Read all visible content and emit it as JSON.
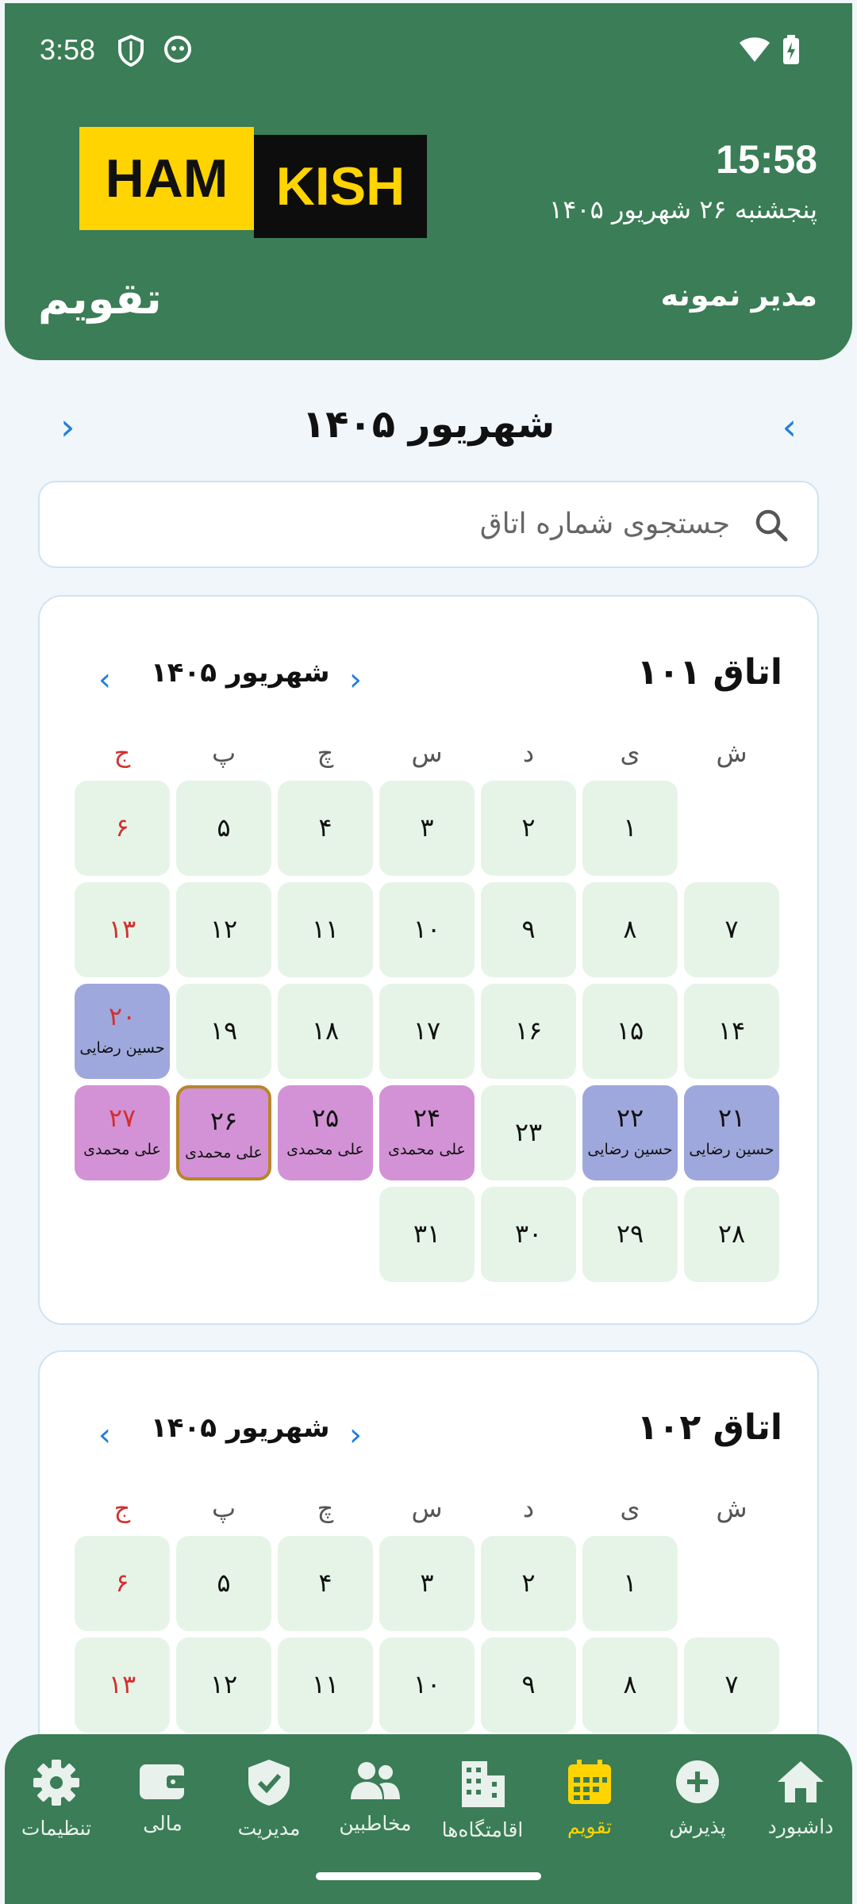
{
  "status_bar": {
    "time": "3:58"
  },
  "header": {
    "logo_left": "HAM",
    "logo_right": "KISH",
    "clock": "15:58",
    "date": "پنجشنبه ۲۶ شهریور ۱۴۰۵",
    "page_title": "تقویم",
    "user_name": "مدیر نمونه"
  },
  "month_nav": {
    "title": "شهریور ۱۴۰۵",
    "prev_arrow": "‹",
    "next_arrow": "›"
  },
  "search": {
    "placeholder": "جستجوی شماره اتاق"
  },
  "weekdays": [
    "ش",
    "ی",
    "د",
    "س",
    "چ",
    "پ",
    "ج"
  ],
  "rooms": [
    {
      "title": "اتاق ۱۰۱",
      "month": "شهریور ۱۴۰۵",
      "days": [
        {
          "n": "۱"
        },
        {
          "n": "۲"
        },
        {
          "n": "۳"
        },
        {
          "n": "۴"
        },
        {
          "n": "۵"
        },
        {
          "n": "۶"
        },
        {
          "n": "۷"
        },
        {
          "n": "۸"
        },
        {
          "n": "۹"
        },
        {
          "n": "۱۰"
        },
        {
          "n": "۱۱"
        },
        {
          "n": "۱۲"
        },
        {
          "n": "۱۳"
        },
        {
          "n": "۱۴"
        },
        {
          "n": "۱۵"
        },
        {
          "n": "۱۶"
        },
        {
          "n": "۱۷"
        },
        {
          "n": "۱۸"
        },
        {
          "n": "۱۹"
        },
        {
          "n": "۲۰",
          "guest": "حسین رضایی"
        },
        {
          "n": "۲۱",
          "guest": "حسین رضایی"
        },
        {
          "n": "۲۲",
          "guest": "حسین رضایی"
        },
        {
          "n": "۲۳"
        },
        {
          "n": "۲۴",
          "guest": "علی محمدی"
        },
        {
          "n": "۲۵",
          "guest": "علی محمدی"
        },
        {
          "n": "۲۶",
          "guest": "علی محمدی"
        },
        {
          "n": "۲۷",
          "guest": "علی محمدی"
        },
        {
          "n": "۲۸"
        },
        {
          "n": "۲۹"
        },
        {
          "n": "۳۰"
        },
        {
          "n": "۳۱"
        }
      ]
    },
    {
      "title": "اتاق ۱۰۲",
      "month": "شهریور ۱۴۰۵",
      "days": [
        {
          "n": "۱"
        },
        {
          "n": "۲"
        },
        {
          "n": "۳"
        },
        {
          "n": "۴"
        },
        {
          "n": "۵"
        },
        {
          "n": "۶"
        },
        {
          "n": "۷"
        },
        {
          "n": "۸"
        },
        {
          "n": "۹"
        },
        {
          "n": "۱۰"
        },
        {
          "n": "۱۱"
        },
        {
          "n": "۱۲"
        },
        {
          "n": "۱۳"
        }
      ]
    }
  ],
  "bottom_nav": [
    {
      "label": "داشبورد",
      "icon": "home-icon"
    },
    {
      "label": "پذیرش",
      "icon": "add-circle-icon"
    },
    {
      "label": "تقویم",
      "icon": "calendar-icon",
      "active": true
    },
    {
      "label": "اقامتگاه‌ها",
      "icon": "building-icon"
    },
    {
      "label": "مخاطبین",
      "icon": "people-icon"
    },
    {
      "label": "مدیریت",
      "icon": "shield-check-icon"
    },
    {
      "label": "مالی",
      "icon": "wallet-icon"
    },
    {
      "label": "تنظیمات",
      "icon": "gear-icon"
    }
  ],
  "colors": {
    "primary": "#3a7d56",
    "accent": "#ffd400",
    "day_free": "#e6f4e8",
    "guest_blue": "#9fa8dc",
    "guest_purple": "#d392d6",
    "holiday": "#d32f2f",
    "link": "#1e7fe0"
  }
}
